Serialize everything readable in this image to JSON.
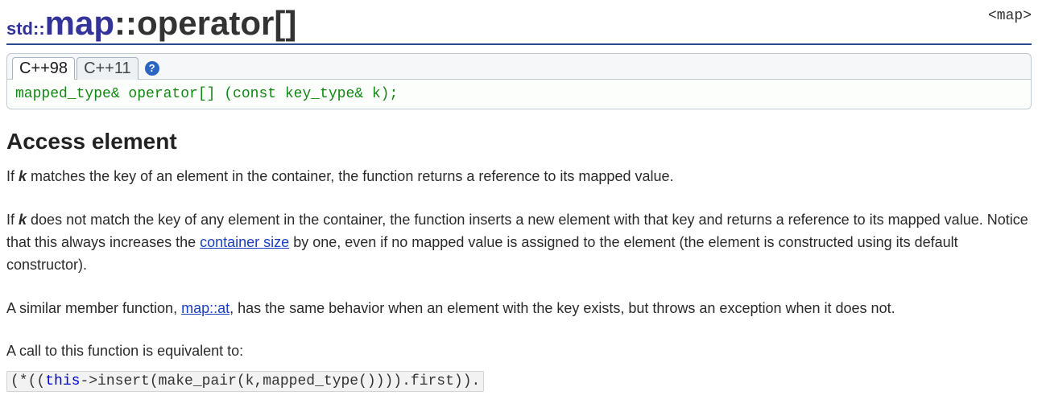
{
  "header": {
    "title_prefix": "std::",
    "title_main": "map",
    "title_sep": "::",
    "title_suffix": "operator[]",
    "hint": "<map>"
  },
  "tabs": {
    "items": [
      "C++98",
      "C++11"
    ],
    "help_glyph": "?"
  },
  "signature": "mapped_type& operator[] (const key_type& k);",
  "section_title": "Access element",
  "para1": {
    "pre": "If ",
    "key": "k",
    "post": " matches the key of an element in the container, the function returns a reference to its mapped value."
  },
  "para2": {
    "pre": "If ",
    "key": "k",
    "mid1": " does not match the key of any element in the container, the function inserts a new element with that key and returns a reference to its mapped value. Notice that this always increases the ",
    "link1": "container size",
    "mid2": " by one, even if no mapped value is assigned to the element (the element is constructed using its default constructor)."
  },
  "para3": {
    "pre": "A similar member function, ",
    "link1": "map::at",
    "post": ", has the same behavior when an element with the key exists, but throws an exception when it does not."
  },
  "para4": "A call to this function is equivalent to:",
  "equiv_code": {
    "p1": "(*((",
    "kw": "this",
    "p2": "->insert(make_pair(k,mapped_type()))).first))."
  }
}
